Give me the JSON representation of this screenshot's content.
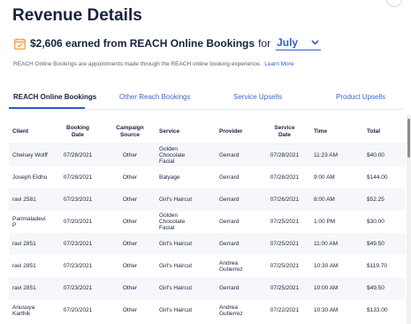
{
  "header": {
    "title": "Revenue Details"
  },
  "summary": {
    "text": "$2,606 earned from REACH Online Bookings",
    "for_label": "for",
    "month": "July"
  },
  "info": {
    "text": "REACH Online Bookings are appointments made through the REACH online booking experience.",
    "link": "Learn More"
  },
  "tabs": [
    {
      "label": "REACH Online Bookings",
      "active": true
    },
    {
      "label": "Other Reach Bookings"
    },
    {
      "label": "Service Upsells"
    },
    {
      "label": "Product Upsells"
    }
  ],
  "table": {
    "columns": [
      {
        "line1": "Client",
        "line2": ""
      },
      {
        "line1": "Booking",
        "line2": "Date"
      },
      {
        "line1": "Campaign",
        "line2": "Source"
      },
      {
        "line1": "Service",
        "line2": ""
      },
      {
        "line1": "Provider",
        "line2": ""
      },
      {
        "line1": "Service",
        "line2": "Date"
      },
      {
        "line1": "Time",
        "line2": ""
      },
      {
        "line1": "Total",
        "line2": ""
      }
    ],
    "rows": [
      [
        "Chelsey Wolff",
        "07/28/2021",
        "Other",
        "Golden\nChocolate\nFacial",
        "Gerrard",
        "07/28/2021",
        "11:23 AM",
        "$40.00"
      ],
      [
        "Joseph Eldho",
        "07/28/2021",
        "Other",
        "Balyage",
        "Gerrard",
        "07/28/2021",
        "9:00 AM",
        "$144.00"
      ],
      [
        "ravi 2581",
        "07/23/2021",
        "Other",
        "Girl's Haircut",
        "Gerrard",
        "07/26/2021",
        "8:00 AM",
        "$52.25"
      ],
      [
        "Parimaladevi\nP",
        "07/20/2021",
        "Other",
        "Golden\nChocolate\nFacial",
        "Gerrard",
        "07/25/2021",
        "1:00 PM",
        "$30.00"
      ],
      [
        "ravi 2851",
        "07/23/2021",
        "Other",
        "Girl's Haircut",
        "Gerrard",
        "07/25/2021",
        "11:00 AM",
        "$49.50"
      ],
      [
        "ravi 2851",
        "07/23/2021",
        "Other",
        "Girl's Haircut",
        "Andrea\nGutierrez",
        "07/25/2021",
        "10:30 AM",
        "$119.70"
      ],
      [
        "ravi 2851",
        "07/23/2021",
        "Other",
        "Girl's Haircut",
        "Gerrard",
        "07/25/2021",
        "10:00 AM",
        "$49.50"
      ],
      [
        "Anusuya\nKarthik",
        "07/20/2021",
        "Other",
        "Girl's Haircut",
        "Andrea\nGutierrez",
        "07/22/2021",
        "10:30 AM",
        "$133.00"
      ]
    ]
  },
  "colors": {
    "accent": "#2f5fd0",
    "title": "#17213f",
    "icon": "#f29d38",
    "row_alt": "#f6f7fa"
  }
}
